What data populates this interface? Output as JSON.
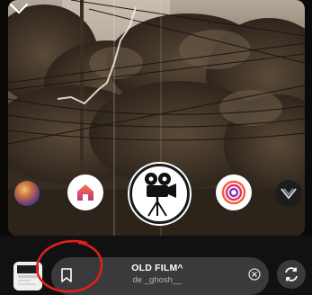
{
  "effect_bar": {
    "title": "OLD FILM^",
    "author": "de _ghosh__"
  },
  "icons": {
    "collapse": "chevron-down-icon",
    "save": "bookmark-icon",
    "clear": "close-circle-icon",
    "flip": "flip-camera-icon",
    "selected_effect": "film-camera-icon"
  },
  "colors": {
    "annotation": "#e0201b",
    "home_gradient_top": "#f77737",
    "home_gradient_bottom": "#c13584",
    "pill": "#3a3a3c"
  }
}
